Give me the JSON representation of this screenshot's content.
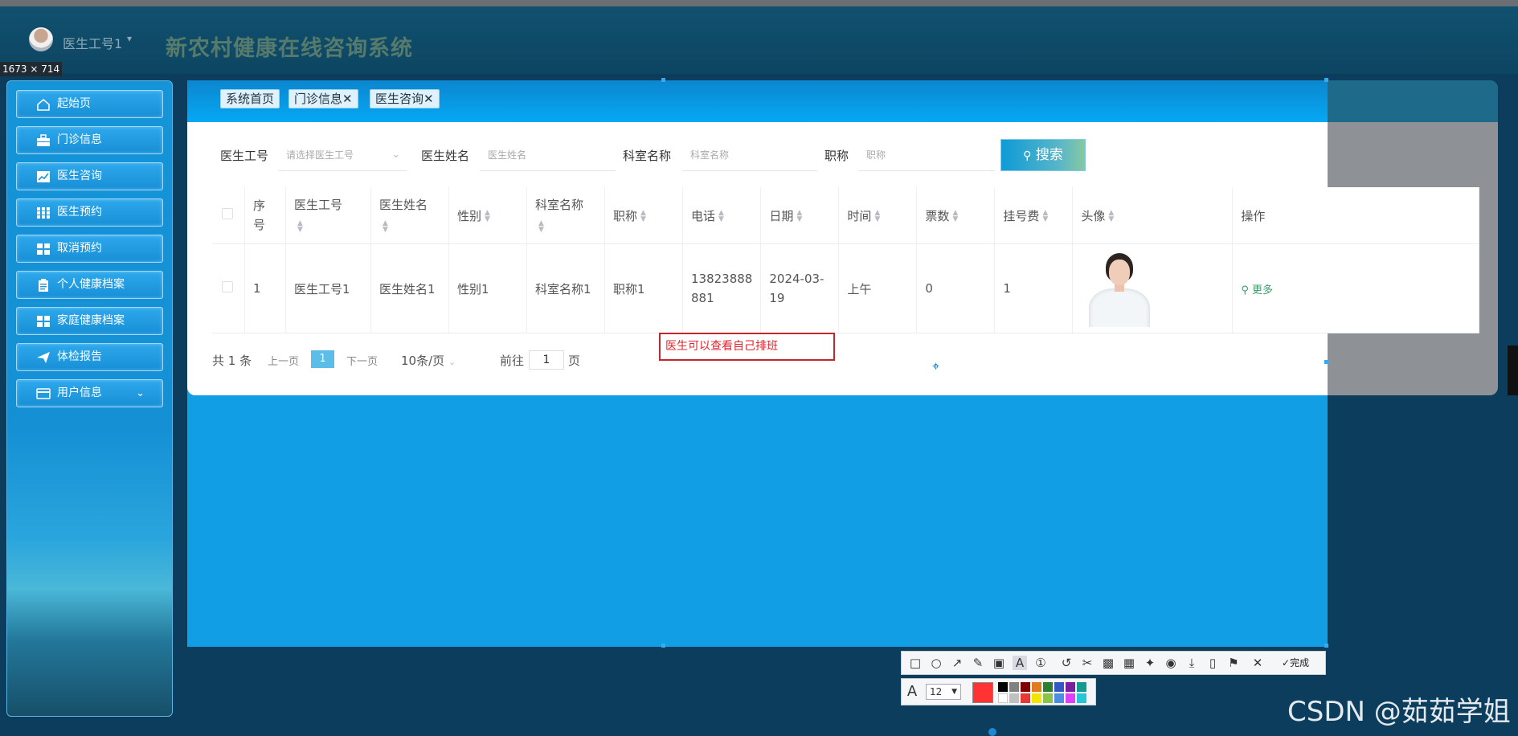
{
  "header": {
    "user_name": "医生工号1",
    "caret": "▾",
    "app_title": "新农村健康在线咨询系统",
    "screen_size": "1673 × 714"
  },
  "sidebar": {
    "items": [
      {
        "label": "起始页",
        "icon": "home-icon"
      },
      {
        "label": "门诊信息",
        "icon": "briefcase-icon"
      },
      {
        "label": "医生咨询",
        "icon": "chart-icon"
      },
      {
        "label": "医生预约",
        "icon": "grid-icon"
      },
      {
        "label": "取消预约",
        "icon": "grid-icon"
      },
      {
        "label": "个人健康档案",
        "icon": "clipboard-icon"
      },
      {
        "label": "家庭健康档案",
        "icon": "grid-icon"
      },
      {
        "label": "体检报告",
        "icon": "send-icon"
      },
      {
        "label": "用户信息",
        "icon": "card-icon"
      }
    ]
  },
  "tabs": [
    {
      "label": "系统首页"
    },
    {
      "label": "门诊信息",
      "close": "✕"
    },
    {
      "label": "医生咨询",
      "close": "✕"
    }
  ],
  "search": {
    "doctor_id_label": "医生工号",
    "doctor_id_placeholder": "请选择医生工号",
    "doctor_name_label": "医生姓名",
    "doctor_name_placeholder": "医生姓名",
    "dept_label": "科室名称",
    "dept_placeholder": "科室名称",
    "title_label": "职称",
    "title_placeholder": "职称",
    "button": "搜索"
  },
  "table": {
    "headers": [
      "序号",
      "医生工号",
      "医生姓名",
      "性别",
      "科室名称",
      "职称",
      "电话",
      "日期",
      "时间",
      "票数",
      "挂号费",
      "头像",
      "操作"
    ],
    "header_lines": {
      "seq_1": "序",
      "seq_2": "号"
    },
    "rows": [
      {
        "seq": "1",
        "doctor_id": "医生工号1",
        "doctor_name": "医生姓名1",
        "gender": "性别1",
        "dept": "科室名称1",
        "title": "职称1",
        "phone_1": "13823888",
        "phone_2": "881",
        "date_1": "2024-03-",
        "date_2": "19",
        "time": "上午",
        "tickets": "0",
        "fee": "1",
        "action": "更多"
      }
    ]
  },
  "pager": {
    "total": "共 1 条",
    "prev": "上一页",
    "current": "1",
    "next": "下一页",
    "page_size": "10条/页",
    "goto": "前往",
    "goto_value": "1",
    "page_unit": "页"
  },
  "annotation": "医生可以查看自己排班",
  "capture_toolbar": {
    "done": "完成",
    "font_size": "12",
    "colors": [
      "#000000",
      "#808080",
      "#800000",
      "#e07b20",
      "#2e7d32",
      "#3457c4",
      "#7b1fa2",
      "#129b8f",
      "#ffffff",
      "#c0c0c0",
      "#e53935",
      "#f2e600",
      "#8bc34a",
      "#4a90e2",
      "#e040fb",
      "#26c6da"
    ],
    "selected_color": "#ff3333"
  },
  "watermark": "CSDN @茹茹学姐"
}
